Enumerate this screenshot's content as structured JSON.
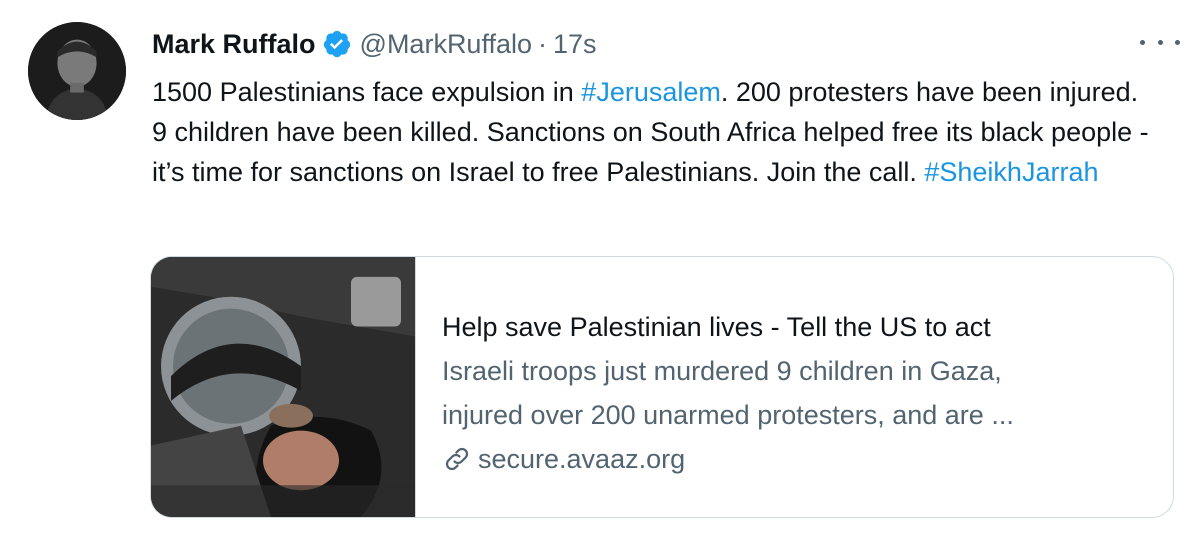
{
  "tweet": {
    "author_name": "Mark Ruffalo",
    "handle": "@MarkRuffalo",
    "separator": "·",
    "time": "17s",
    "text_segments": [
      {
        "text": "1500 Palestinians face expulsion in ",
        "type": "text"
      },
      {
        "text": "#Jerusalem",
        "type": "hashtag"
      },
      {
        "text": ". 200 protesters have been injured. 9 children have been killed. Sanctions on South Africa helped free its black people - it’s time for sanctions on Israel to free Palestinians. Join the call. ",
        "type": "text"
      },
      {
        "text": "#SheikhJarrah",
        "type": "hashtag"
      }
    ]
  },
  "card": {
    "title": "Help save Palestinian lives - Tell the US to act",
    "desc_line1": "Israeli troops just murdered 9 children in Gaza,",
    "desc_line2": "injured over 200 unarmed protesters, and are ...",
    "domain": "secure.avaaz.org"
  },
  "colors": {
    "hashtag": "#1b95e0",
    "verified_badge": "#1da1f2",
    "secondary_text": "#536471",
    "border": "#cfd9de"
  },
  "icons": {
    "verified": "verified-badge-icon",
    "more": "more-options-icon",
    "link": "link-icon"
  }
}
